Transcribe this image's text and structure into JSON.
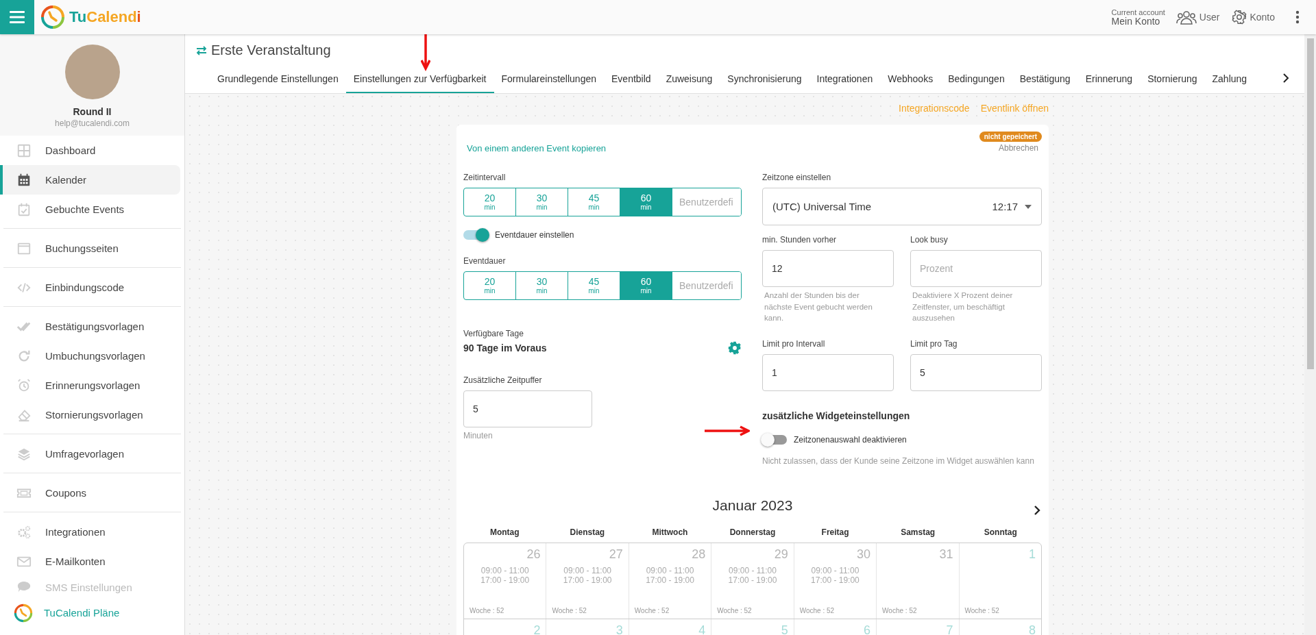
{
  "topbar": {
    "logo": [
      {
        "text": "Tu",
        "color": "#17a398"
      },
      {
        "text": "Calend",
        "color": "#f5a623"
      },
      {
        "text": "i",
        "color": "#e8541c"
      }
    ],
    "account_label": "Current account",
    "account_name": "Mein Konto",
    "user": "User",
    "konto": "Konto"
  },
  "profile": {
    "name": "Round II",
    "email": "help@tucalendi.com"
  },
  "sidebar": {
    "groups": [
      [
        {
          "label": "Dashboard",
          "selected": false,
          "disabled": false
        },
        {
          "label": "Kalender",
          "selected": true,
          "disabled": false
        },
        {
          "label": "Gebuchte Events",
          "selected": false,
          "disabled": false
        }
      ],
      [
        {
          "label": "Buchungsseiten",
          "selected": false,
          "disabled": false
        }
      ],
      [
        {
          "label": "Einbindungscode",
          "selected": false,
          "disabled": false
        }
      ],
      [
        {
          "label": "Bestätigungsvorlagen",
          "selected": false,
          "disabled": false
        },
        {
          "label": "Umbuchungsvorlagen",
          "selected": false,
          "disabled": false
        },
        {
          "label": "Erinnerungsvorlagen",
          "selected": false,
          "disabled": false
        },
        {
          "label": "Stornierungsvorlagen",
          "selected": false,
          "disabled": false
        }
      ],
      [
        {
          "label": "Umfragevorlagen",
          "selected": false,
          "disabled": false
        }
      ],
      [
        {
          "label": "Coupons",
          "selected": false,
          "disabled": false
        }
      ],
      [
        {
          "label": "Integrationen",
          "selected": false,
          "disabled": false
        },
        {
          "label": "E-Mailkonten",
          "selected": false,
          "disabled": false
        },
        {
          "label": "SMS Einstellungen",
          "selected": false,
          "disabled": true
        }
      ]
    ],
    "plans": "TuCalendi Pläne"
  },
  "page": {
    "title": "Erste Veranstaltung",
    "tabs": [
      {
        "label": "Grundlegende Einstellungen",
        "selected": false
      },
      {
        "label": "Einstellungen zur Verfügbarkeit",
        "selected": true
      },
      {
        "label": "Formulareinstellungen",
        "selected": false
      },
      {
        "label": "Eventbild",
        "selected": false
      },
      {
        "label": "Zuweisung",
        "selected": false
      },
      {
        "label": "Synchronisierung",
        "selected": false
      },
      {
        "label": "Integrationen",
        "selected": false
      },
      {
        "label": "Webhooks",
        "selected": false
      },
      {
        "label": "Bedingungen",
        "selected": false
      },
      {
        "label": "Bestätigung",
        "selected": false
      },
      {
        "label": "Erinnerung",
        "selected": false
      },
      {
        "label": "Stornierung",
        "selected": false
      },
      {
        "label": "Zahlung",
        "selected": false
      }
    ],
    "links": [
      "Integrationscode",
      "Eventlink öffnen"
    ]
  },
  "form": {
    "copy_link": "Von einem anderen Event kopieren",
    "badge": "nicht gepeichert",
    "cancel": "Abbrechen",
    "interval": {
      "label": "Zeitintervall",
      "options": [
        {
          "value": "20",
          "unit": "min",
          "selected": false
        },
        {
          "value": "30",
          "unit": "min",
          "selected": false
        },
        {
          "value": "45",
          "unit": "min",
          "selected": false
        },
        {
          "value": "60",
          "unit": "min",
          "selected": true
        }
      ],
      "custom_placeholder": "Benutzerdefi"
    },
    "duration_toggle": {
      "label": "Eventdauer einstellen",
      "on": true
    },
    "duration": {
      "label": "Eventdauer",
      "options": [
        {
          "value": "20",
          "unit": "min",
          "selected": false
        },
        {
          "value": "30",
          "unit": "min",
          "selected": false
        },
        {
          "value": "45",
          "unit": "min",
          "selected": false
        },
        {
          "value": "60",
          "unit": "min",
          "selected": true
        }
      ],
      "custom_placeholder": "Benutzerdefi"
    },
    "available_days": {
      "label": "Verfügbare Tage",
      "value": "90 Tage im Voraus"
    },
    "buffer": {
      "label": "Zusätzliche Zeitpuffer",
      "value": "5",
      "unit": "Minuten"
    },
    "timezone": {
      "label": "Zeitzone einstellen",
      "value": "(UTC) Universal Time",
      "time": "12:17"
    },
    "fields": [
      {
        "label": "min. Stunden vorher",
        "value": "12",
        "help": "Anzahl der Stunden bis der nächste Event gebucht werden kann."
      },
      {
        "label": "Look busy",
        "placeholder": "Prozent",
        "help": "Deaktiviere X Prozent deiner Zeitfenster, um beschäftigt auszusehen"
      },
      {
        "label": "Limit pro Intervall",
        "value": "1"
      },
      {
        "label": "Limit pro Tag",
        "value": "5"
      }
    ],
    "widget": {
      "heading": "zusätzliche Widgeteinstellungen",
      "toggle": {
        "label": "Zeitzonenauswahl deaktivieren",
        "on": false
      },
      "hint": "Nicht zulassen, dass der Kunde seine Zeitzone im Widget auswählen kann"
    }
  },
  "calendar": {
    "title": "Januar 2023",
    "weekdays": [
      "Montag",
      "Dienstag",
      "Mittwoch",
      "Donnerstag",
      "Freitag",
      "Samstag",
      "Sonntag"
    ],
    "weeks": [
      [
        {
          "date": "26",
          "past": true,
          "slots": [
            "09:00 - 11:00",
            "17:00 - 19:00"
          ],
          "week": "Woche : 52"
        },
        {
          "date": "27",
          "past": true,
          "slots": [
            "09:00 - 11:00",
            "17:00 - 19:00"
          ],
          "week": "Woche : 52"
        },
        {
          "date": "28",
          "past": true,
          "slots": [
            "09:00 - 11:00",
            "17:00 - 19:00"
          ],
          "week": "Woche : 52"
        },
        {
          "date": "29",
          "past": true,
          "slots": [
            "09:00 - 11:00",
            "17:00 - 19:00"
          ],
          "week": "Woche : 52"
        },
        {
          "date": "30",
          "past": true,
          "slots": [
            "09:00 - 11:00",
            "17:00 - 19:00"
          ],
          "week": "Woche : 52"
        },
        {
          "date": "31",
          "past": true,
          "week": "Woche : 52"
        },
        {
          "date": "1",
          "past": false,
          "week": "Woche : 52"
        }
      ],
      [
        {
          "date": "2",
          "past": false
        },
        {
          "date": "3",
          "past": false
        },
        {
          "date": "4",
          "past": false
        },
        {
          "date": "5",
          "past": false
        },
        {
          "date": "6",
          "past": false
        },
        {
          "date": "7",
          "past": false
        },
        {
          "date": "8",
          "past": false
        }
      ]
    ]
  }
}
